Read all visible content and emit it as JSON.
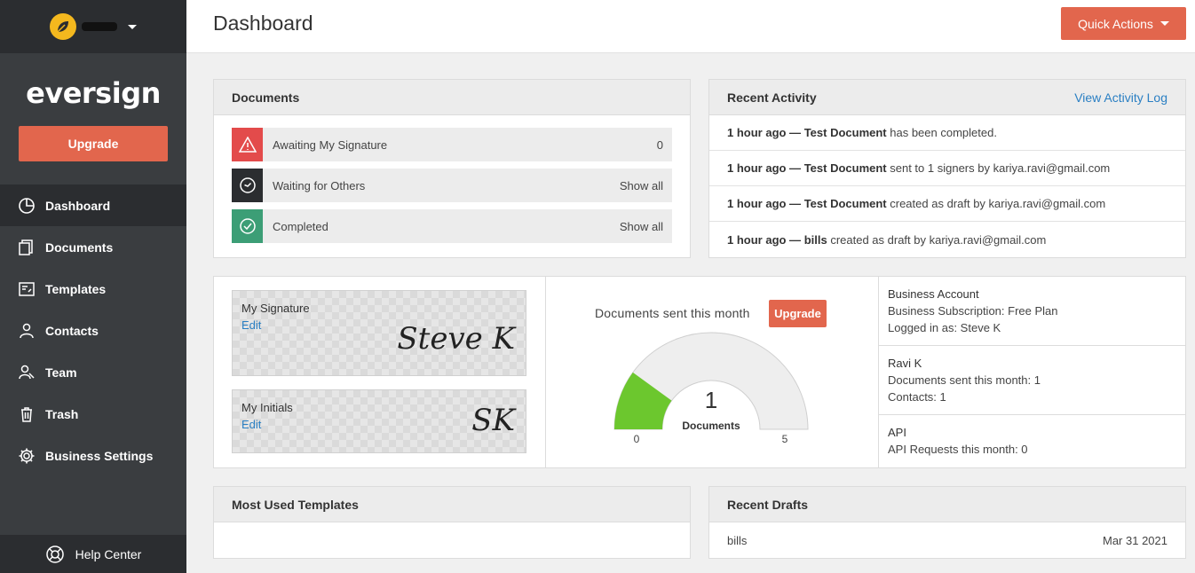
{
  "sidebar": {
    "brand": "eversign",
    "upgrade_label": "Upgrade",
    "items": [
      {
        "label": "Dashboard",
        "icon": "pie-chart-icon",
        "active": true
      },
      {
        "label": "Documents",
        "icon": "documents-icon"
      },
      {
        "label": "Templates",
        "icon": "templates-icon"
      },
      {
        "label": "Contacts",
        "icon": "contacts-icon"
      },
      {
        "label": "Team",
        "icon": "team-icon"
      },
      {
        "label": "Trash",
        "icon": "trash-icon"
      },
      {
        "label": "Business Settings",
        "icon": "gear-icon"
      }
    ],
    "help_label": "Help Center"
  },
  "header": {
    "title": "Dashboard",
    "quick_actions_label": "Quick Actions"
  },
  "documents": {
    "title": "Documents",
    "rows": [
      {
        "label": "Awaiting My Signature",
        "value": "0",
        "color": "#e34b4b"
      },
      {
        "label": "Waiting for Others",
        "value": "Show all",
        "color": "#2b2d30"
      },
      {
        "label": "Completed",
        "value": "Show all",
        "color": "#3c9e76"
      }
    ]
  },
  "activity": {
    "title": "Recent Activity",
    "link": "View Activity Log",
    "rows": [
      {
        "time": "1 hour ago —",
        "doc": "Test Document",
        "text": "has been completed."
      },
      {
        "time": "1 hour ago —",
        "doc": "Test Document",
        "text": "sent to 1 signers by kariya.ravi@gmail.com"
      },
      {
        "time": "1 hour ago —",
        "doc": "Test Document",
        "text": "created as draft by kariya.ravi@gmail.com"
      },
      {
        "time": "1 hour ago —",
        "doc": "bills",
        "text": "created as draft by kariya.ravi@gmail.com"
      }
    ]
  },
  "signature": {
    "title": "My Signature",
    "edit": "Edit",
    "script": "Steve K"
  },
  "initials": {
    "title": "My Initials",
    "edit": "Edit",
    "script": "SK"
  },
  "usage": {
    "title": "Documents sent this month",
    "upgrade_label": "Upgrade",
    "value": "1",
    "value_number": 1,
    "unit": "Documents",
    "min": "0",
    "max": "5",
    "max_number": 5
  },
  "account": {
    "business_title": "Business Account",
    "business_plan": "Business Subscription: Free Plan",
    "business_logged": "Logged in as: Steve K",
    "user_title": "Ravi K",
    "user_docs": "Documents sent this month: 1",
    "user_contacts": "Contacts: 1",
    "api_title": "API",
    "api_requests": "API Requests this month: 0"
  },
  "templates": {
    "title": "Most Used Templates"
  },
  "drafts": {
    "title": "Recent Drafts",
    "rows": [
      {
        "name": "bills",
        "date": "Mar 31 2021"
      }
    ]
  },
  "colors": {
    "accent": "#e2664d",
    "sidebar": "#3a3d40",
    "gauge_fill": "#6cc72e",
    "link": "#2a7fc3"
  }
}
